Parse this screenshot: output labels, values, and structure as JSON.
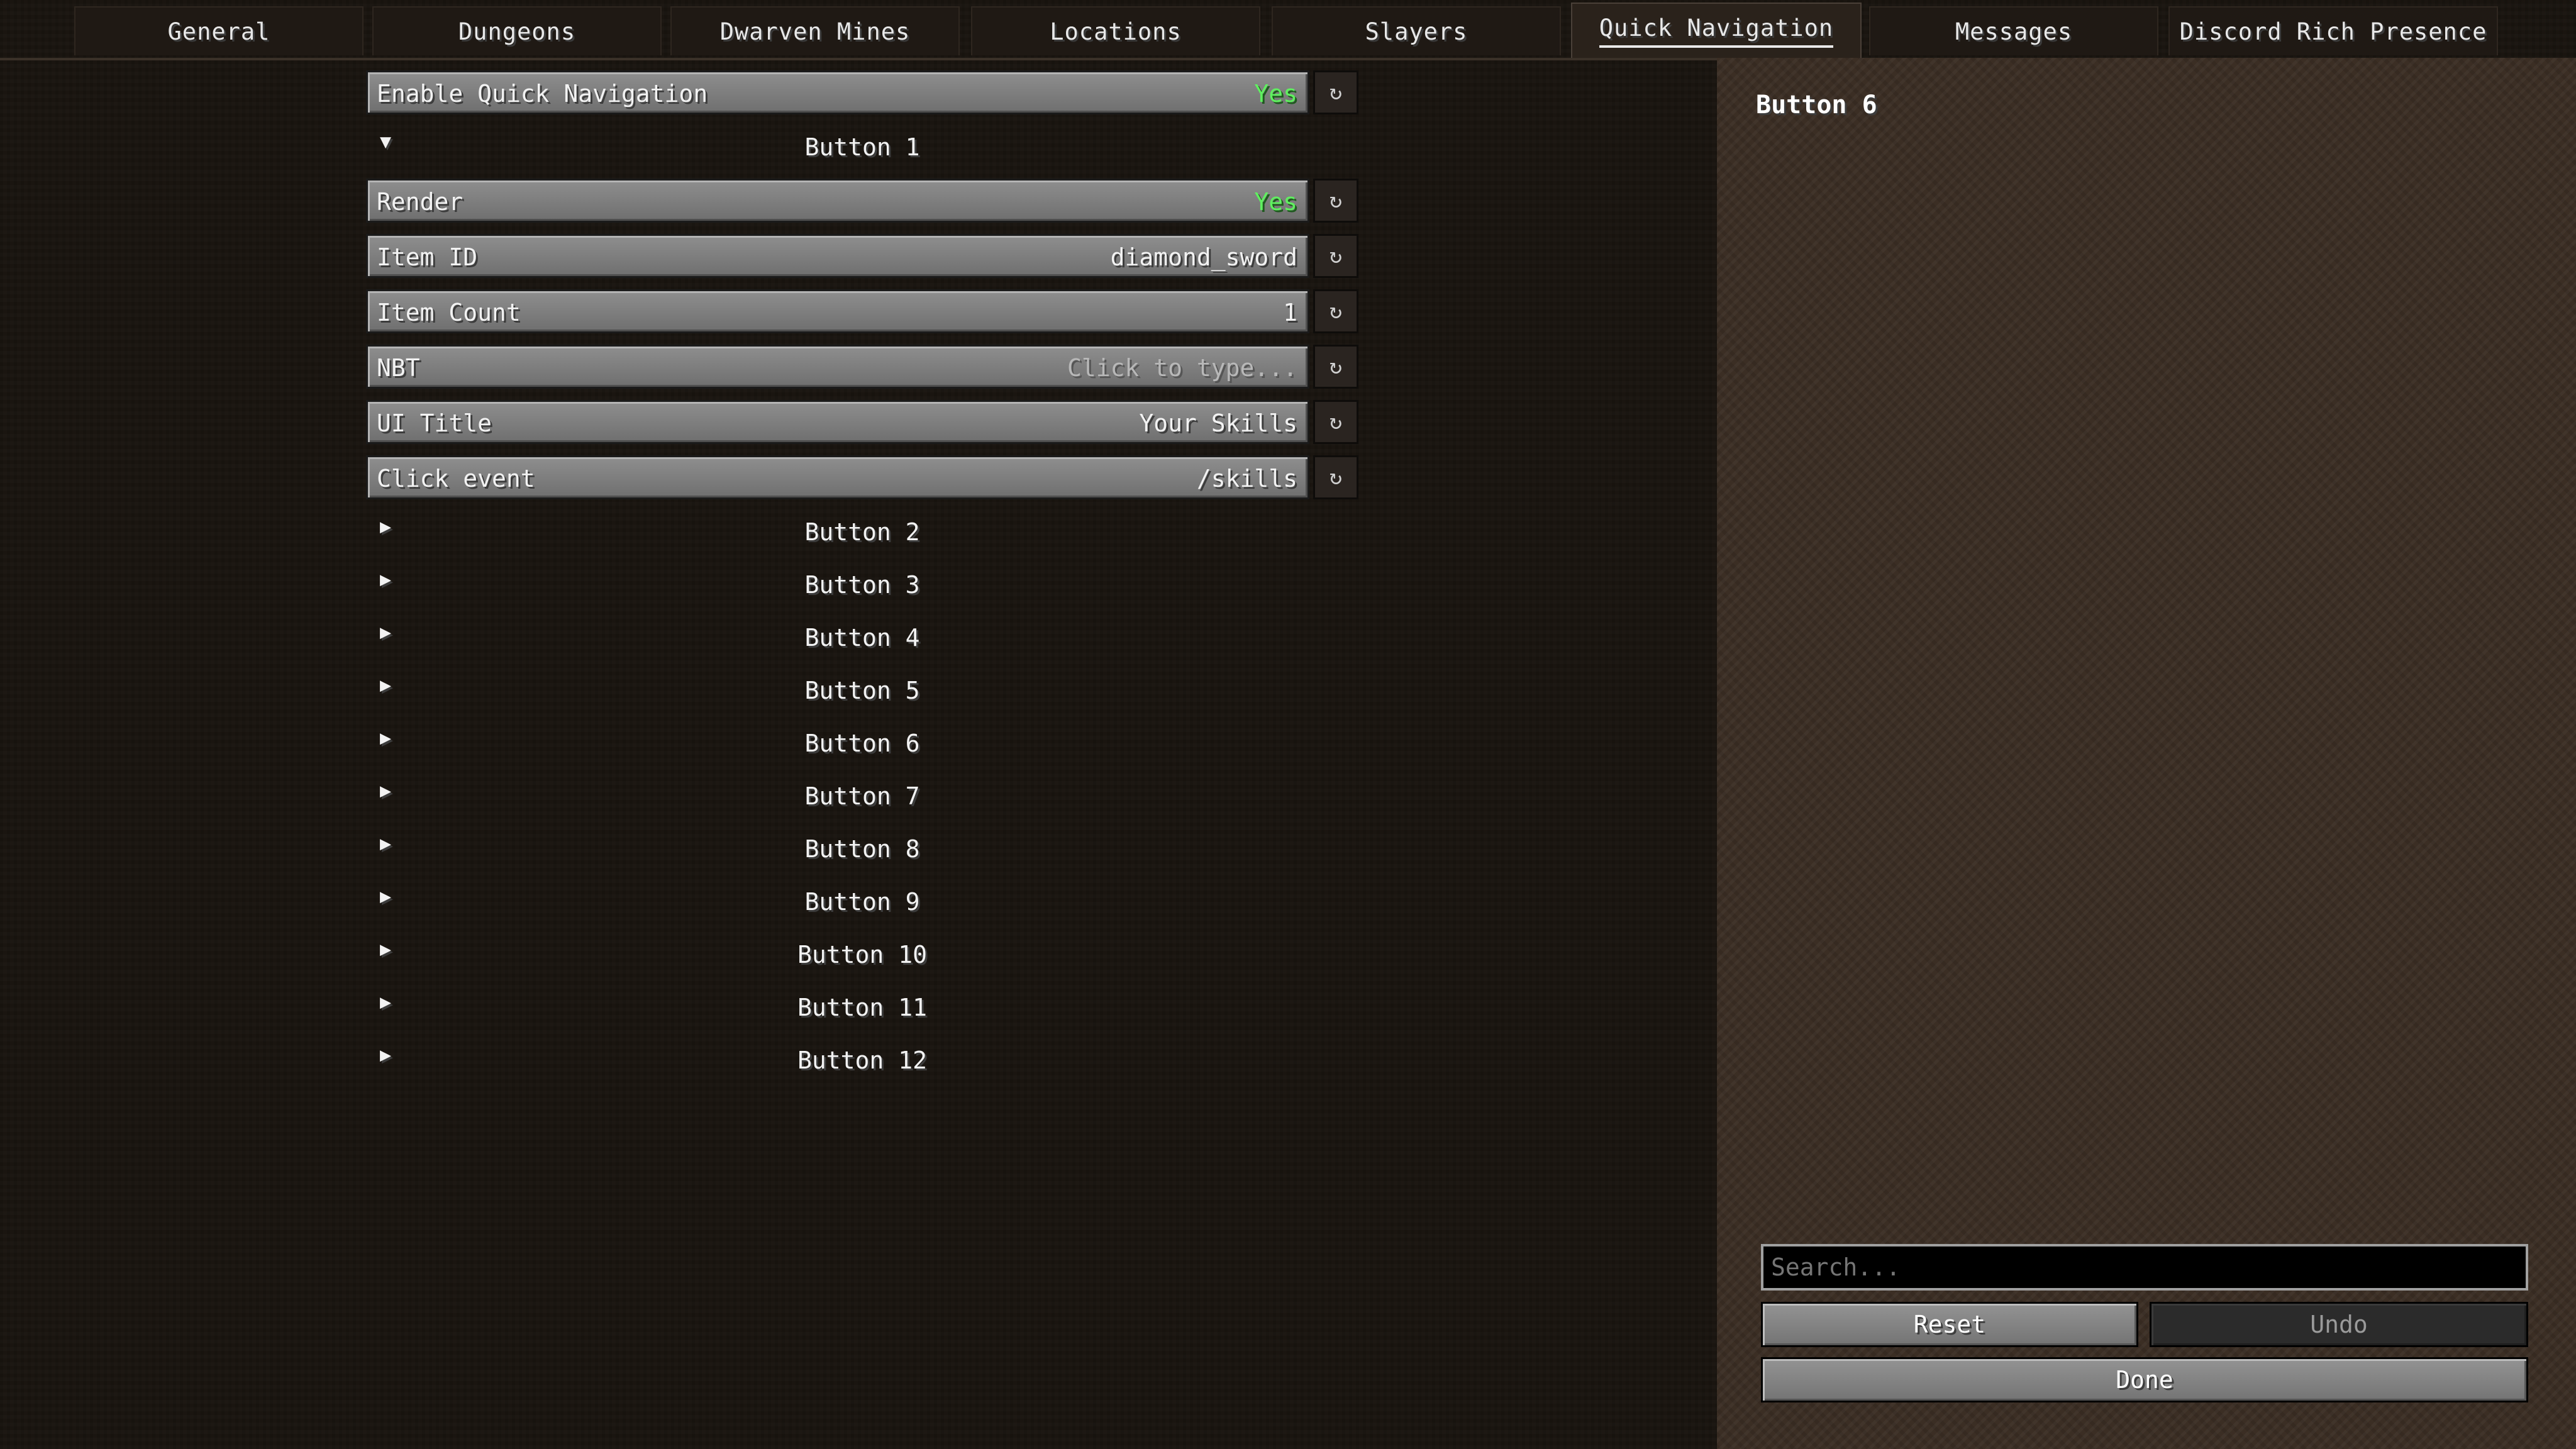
{
  "tabs": [
    {
      "label": "General"
    },
    {
      "label": "Dungeons"
    },
    {
      "label": "Dwarven Mines"
    },
    {
      "label": "Locations"
    },
    {
      "label": "Slayers"
    },
    {
      "label": "Quick Navigation"
    },
    {
      "label": "Messages"
    },
    {
      "label": "Discord Rich Presence"
    }
  ],
  "active_tab": "Quick Navigation",
  "options": {
    "enable_quick_navigation": {
      "label": "Enable Quick Navigation",
      "value": "Yes"
    },
    "button1": {
      "label": "Button 1",
      "expanded": true,
      "render": {
        "label": "Render",
        "value": "Yes"
      },
      "item_id": {
        "label": "Item ID",
        "value": "diamond_sword"
      },
      "item_count": {
        "label": "Item Count",
        "value": "1"
      },
      "nbt": {
        "label": "NBT",
        "placeholder": "Click to type..."
      },
      "ui_title": {
        "label": "UI Title",
        "value": "Your Skills"
      },
      "click_event": {
        "label": "Click event",
        "value": "/skills"
      }
    },
    "collapsed_groups": [
      "Button 2",
      "Button 3",
      "Button 4",
      "Button 5",
      "Button 6",
      "Button 7",
      "Button 8",
      "Button 9",
      "Button 10",
      "Button 11",
      "Button 12"
    ]
  },
  "icons": {
    "reset": "↻",
    "expanded_arrow": "▼",
    "collapsed_arrow": "▶"
  },
  "side_panel": {
    "title": "Button 6",
    "search_placeholder": "Search...",
    "reset_label": "Reset",
    "undo_label": "Undo",
    "done_label": "Done"
  },
  "colors": {
    "yes": "#5ff05f",
    "placeholder": "#b8b8b8"
  }
}
